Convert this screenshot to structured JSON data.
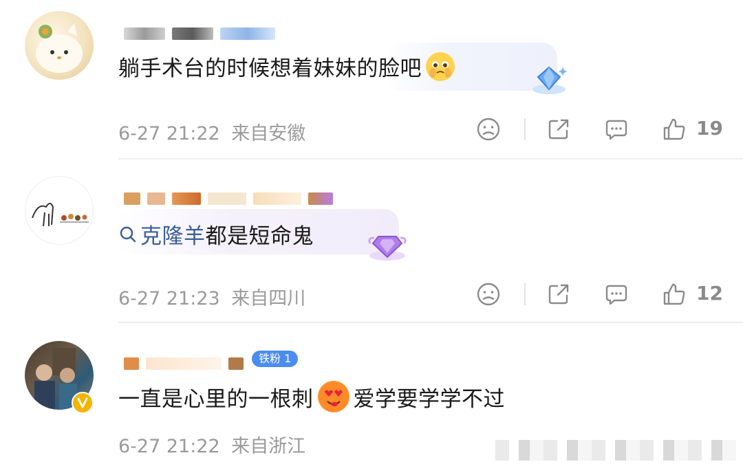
{
  "comments": [
    {
      "text": "躺手术台的时候想着妹妹的脸吧",
      "emoji": "crying-pleading-face",
      "date": "6-27 21:22",
      "location": "来自安徽",
      "likes": "19"
    },
    {
      "search_link": "克隆羊",
      "text": "都是短命鬼",
      "date": "6-27 21:23",
      "location": "来自四川",
      "likes": "12"
    },
    {
      "text_before": "一直是心里的一根刺",
      "emoji": "heart-eyes-face",
      "text_after": "爱学要学学不过",
      "date": "6-27 21:22",
      "location": "来自浙江",
      "fan_badge": "铁粉 1"
    }
  ],
  "colors": {
    "link": "#3b5e99",
    "meta_text": "#9a9a9a",
    "icon_gray": "#8a8a8a",
    "badge_blue": "#4a8cf0",
    "badge_purple": "#b07de8",
    "verified_gold": "#f5b400"
  }
}
